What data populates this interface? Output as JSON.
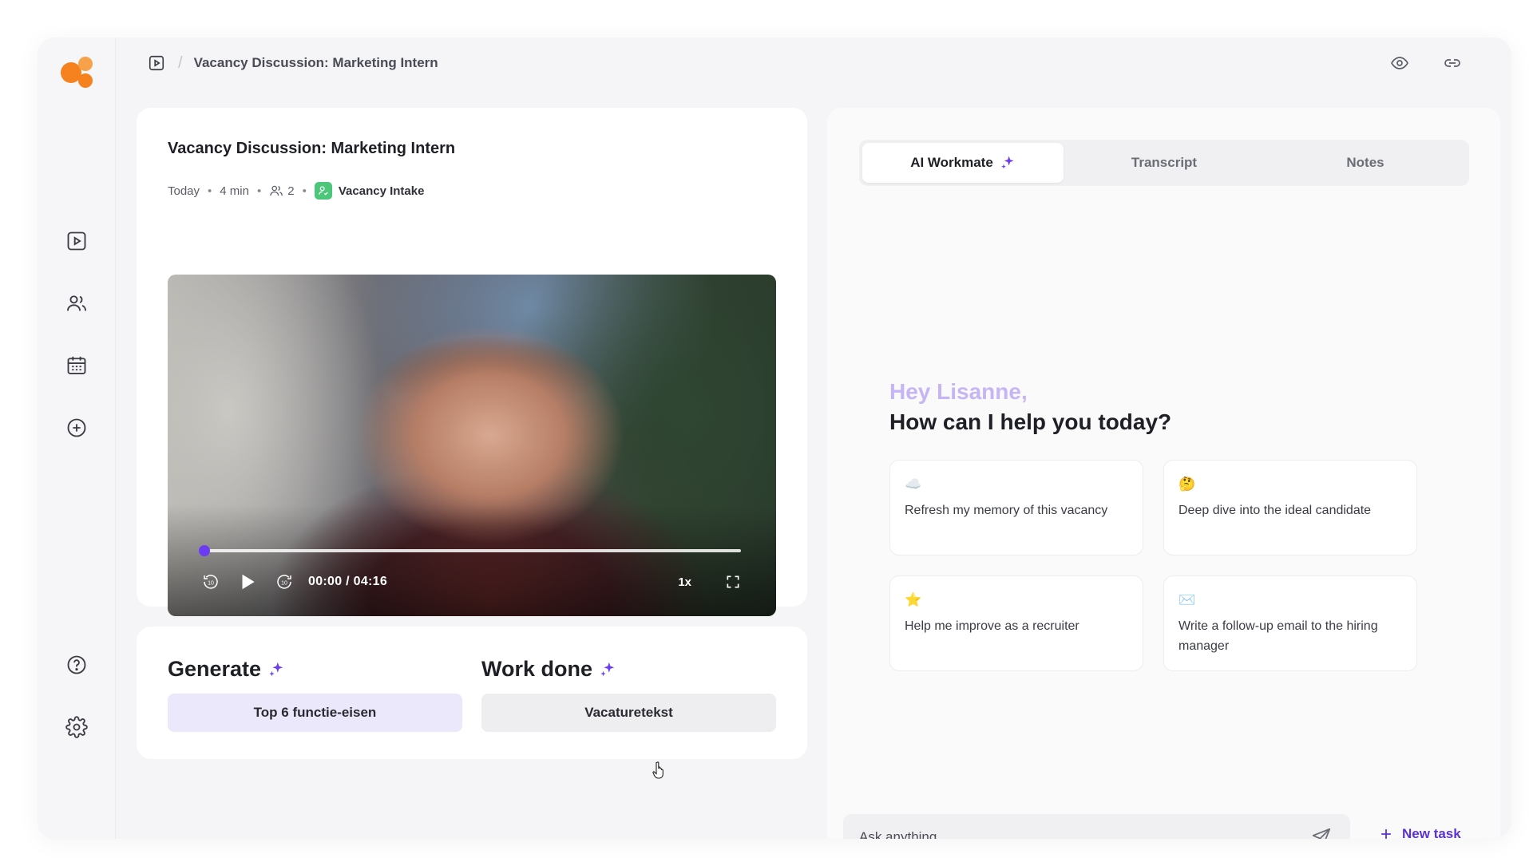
{
  "header": {
    "breadcrumb": "Vacancy Discussion: Marketing Intern"
  },
  "sidebar": {
    "items": [
      {
        "name": "recordings",
        "icon": "play-square-icon"
      },
      {
        "name": "candidates",
        "icon": "users-icon"
      },
      {
        "name": "calendar",
        "icon": "calendar-icon"
      },
      {
        "name": "add",
        "icon": "plus-circle-icon"
      },
      {
        "name": "help",
        "icon": "question-circle-icon"
      },
      {
        "name": "settings",
        "icon": "gear-icon"
      }
    ]
  },
  "meeting": {
    "title": "Vacancy Discussion: Marketing Intern",
    "date": "Today",
    "duration": "4 min",
    "participants": "2",
    "template": "Vacancy Intake"
  },
  "video": {
    "time": "00:00 / 04:16",
    "speed": "1x",
    "progress": 0.0
  },
  "generate": {
    "heading": "Generate",
    "button": "Top 6 functie-eisen"
  },
  "workdone": {
    "heading": "Work done",
    "button": "Vacaturetekst"
  },
  "tabs": [
    {
      "label": "AI Workmate",
      "active": true
    },
    {
      "label": "Transcript",
      "active": false
    },
    {
      "label": "Notes",
      "active": false
    }
  ],
  "assistant": {
    "greeting": "Hey Lisanne,",
    "question": "How can I help you today?",
    "suggestions": [
      {
        "emoji": "☁️",
        "text": "Refresh my memory of this vacancy"
      },
      {
        "emoji": "🤔",
        "text": "Deep dive into the ideal candidate"
      },
      {
        "emoji": "⭐",
        "text": "Help me improve as a recruiter"
      },
      {
        "emoji": "✉️",
        "text": "Write a follow-up email to the hiring manager"
      }
    ],
    "input_placeholder": "Ask anything...",
    "new_task": "New task"
  },
  "colors": {
    "accent": "#6c3cf5",
    "logo": "#f5821f",
    "badge": "#4cc77a",
    "greeting": "#c6b5f5"
  }
}
